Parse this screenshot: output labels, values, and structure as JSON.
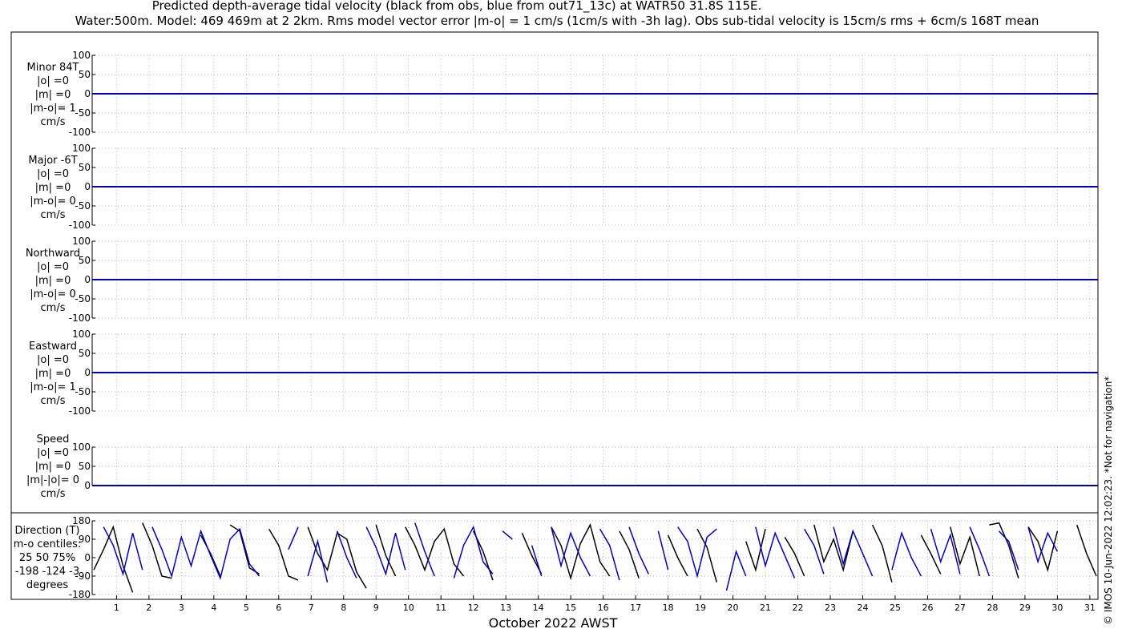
{
  "title": {
    "line1": "Predicted depth-average tidal velocity (black from obs, blue from out71_13c) at WATR50 31.8S 115E.",
    "line2": "Water:500m. Model: 469 469m at 2 2km. Rms model vector error |m-o| = 1 cm/s (1cm/s with -3h lag). Obs sub-tidal velocity is 15cm/s rms + 6cm/s 168T mean"
  },
  "credit": "© IMOS 10-Jun-2022 12:02:23. *Not for navigation*",
  "colors": {
    "obs": "#000000",
    "model": "#0000c0"
  },
  "chart_data": [
    {
      "type": "line",
      "label_lines": [
        "Minor 84T",
        "|o| =0",
        "|m| =0",
        "|m-o|= 1",
        "cm/s"
      ],
      "ylim": [
        -100,
        100
      ],
      "yticks": [
        "100",
        "50",
        "0",
        "-50",
        "-100"
      ],
      "series": [
        {
          "values": [
            0,
            0,
            0,
            0,
            0,
            0,
            0,
            0,
            0,
            0,
            0,
            0,
            0,
            0,
            0,
            0,
            0,
            0,
            0,
            0,
            0,
            0,
            0,
            0,
            0,
            0,
            0,
            0,
            0,
            0,
            0,
            0
          ]
        },
        {
          "values": [
            0,
            0,
            0,
            0,
            0,
            0,
            0,
            0,
            0,
            0,
            0,
            0,
            0,
            0,
            0,
            0,
            0,
            0,
            0,
            0,
            0,
            0,
            0,
            0,
            0,
            0,
            0,
            0,
            0,
            0,
            0,
            0
          ]
        }
      ]
    },
    {
      "type": "line",
      "label_lines": [
        "Major -6T",
        "|o| =0",
        "|m| =0",
        "|m-o|= 0",
        "cm/s"
      ],
      "ylim": [
        -100,
        100
      ],
      "yticks": [
        "100",
        "50",
        "0",
        "-50",
        "-100"
      ],
      "series": [
        {
          "values": [
            0,
            0,
            0,
            0,
            0,
            0,
            0,
            0,
            0,
            0,
            0,
            0,
            0,
            0,
            0,
            0,
            0,
            0,
            0,
            0,
            0,
            0,
            0,
            0,
            0,
            0,
            0,
            0,
            0,
            0,
            0,
            0
          ]
        },
        {
          "values": [
            0,
            0,
            0,
            0,
            0,
            0,
            0,
            0,
            0,
            0,
            0,
            0,
            0,
            0,
            0,
            0,
            0,
            0,
            0,
            0,
            0,
            0,
            0,
            0,
            0,
            0,
            0,
            0,
            0,
            0,
            0,
            0
          ]
        }
      ]
    },
    {
      "type": "line",
      "label_lines": [
        "Northward",
        "|o| =0",
        "|m| =0",
        "|m-o|= 0",
        "cm/s"
      ],
      "ylim": [
        -100,
        100
      ],
      "yticks": [
        "100",
        "50",
        "0",
        "-50",
        "-100"
      ],
      "series": [
        {
          "values": [
            0,
            0,
            0,
            0,
            0,
            0,
            0,
            0,
            0,
            0,
            0,
            0,
            0,
            0,
            0,
            0,
            0,
            0,
            0,
            0,
            0,
            0,
            0,
            0,
            0,
            0,
            0,
            0,
            0,
            0,
            0,
            0
          ]
        },
        {
          "values": [
            0,
            0,
            0,
            0,
            0,
            0,
            0,
            0,
            0,
            0,
            0,
            0,
            0,
            0,
            0,
            0,
            0,
            0,
            0,
            0,
            0,
            0,
            0,
            0,
            0,
            0,
            0,
            0,
            0,
            0,
            0,
            0
          ]
        }
      ]
    },
    {
      "type": "line",
      "label_lines": [
        "Eastward",
        "|o| =0",
        "|m| =0",
        "|m-o|= 1",
        "cm/s"
      ],
      "ylim": [
        -100,
        100
      ],
      "yticks": [
        "100",
        "50",
        "0",
        "-50",
        "-100"
      ],
      "series": [
        {
          "values": [
            0,
            0,
            0,
            0,
            0,
            0,
            0,
            0,
            0,
            0,
            0,
            0,
            0,
            0,
            0,
            0,
            0,
            0,
            0,
            0,
            0,
            0,
            0,
            0,
            0,
            0,
            0,
            0,
            0,
            0,
            0,
            0
          ]
        },
        {
          "values": [
            0,
            0,
            0,
            0,
            0,
            0,
            0,
            0,
            0,
            0,
            0,
            0,
            0,
            0,
            0,
            0,
            0,
            0,
            0,
            0,
            0,
            0,
            0,
            0,
            0,
            0,
            0,
            0,
            0,
            0,
            0,
            0
          ]
        }
      ]
    },
    {
      "type": "line",
      "label_lines": [
        "Speed",
        "|o| =0",
        "|m| =0",
        "|m|-|o|= 0",
        "cm/s"
      ],
      "ylim": [
        0,
        100
      ],
      "yticks": [
        "100",
        "50",
        "0"
      ],
      "series": [
        {
          "values": [
            0,
            0,
            0,
            0,
            0,
            0,
            0,
            0,
            0,
            0,
            0,
            0,
            0,
            0,
            0,
            0,
            0,
            0,
            0,
            0,
            0,
            0,
            0,
            0,
            0,
            0,
            0,
            0,
            0,
            0,
            0,
            0
          ]
        },
        {
          "values": [
            0,
            0,
            0,
            0,
            0,
            0,
            0,
            0,
            0,
            0,
            0,
            0,
            0,
            0,
            0,
            0,
            0,
            0,
            0,
            0,
            0,
            0,
            0,
            0,
            0,
            0,
            0,
            0,
            0,
            0,
            0,
            0
          ]
        }
      ]
    },
    {
      "type": "line",
      "label_lines": [
        "Direction (T)",
        "m-o centiles:",
        "25  50  75%",
        "-198 -124   -3",
        "degrees"
      ],
      "ylim": [
        -180,
        180
      ],
      "yticks": [
        "180",
        "90",
        "0",
        "-90",
        "-180"
      ],
      "x": [
        0.3,
        0.6,
        0.9,
        1.2,
        1.5,
        1.8,
        2.1,
        2.4,
        2.7,
        3.0,
        3.3,
        3.6,
        3.9,
        4.2,
        4.5,
        4.8,
        5.1,
        5.4,
        5.7,
        6.0,
        6.3,
        6.6,
        6.9,
        7.2,
        7.5,
        7.8,
        8.1,
        8.4,
        8.7,
        9.0,
        9.3,
        9.6,
        9.9,
        10.2,
        10.5,
        10.8,
        11.1,
        11.4,
        11.7,
        12.0,
        12.3,
        12.6,
        12.9,
        13.2,
        13.5,
        13.8,
        14.1,
        14.4,
        14.7,
        15.0,
        15.3,
        15.6,
        15.9,
        16.2,
        16.5,
        16.8,
        17.1,
        17.4,
        17.7,
        18.0,
        18.3,
        18.6,
        18.9,
        19.2,
        19.5,
        19.8,
        20.1,
        20.4,
        20.7,
        21.0,
        21.3,
        21.6,
        21.9,
        22.2,
        22.5,
        22.8,
        23.1,
        23.4,
        23.7,
        24.0,
        24.3,
        24.6,
        24.9,
        25.2,
        25.5,
        25.8,
        26.1,
        26.4,
        26.7,
        27.0,
        27.3,
        27.6,
        27.9,
        28.2,
        28.5,
        28.8,
        29.1,
        29.4,
        29.7,
        30.0,
        30.3,
        30.6,
        30.9,
        31.2
      ],
      "series": [
        {
          "values": [
            -60,
            40,
            150,
            -40,
            -170,
            170,
            60,
            -90,
            -100,
            150,
            -170,
            110,
            20,
            -90,
            160,
            130,
            -50,
            -80,
            140,
            60,
            -90,
            -110,
            150,
            20,
            -60,
            120,
            90,
            -70,
            -150,
            160,
            10,
            -90,
            150,
            60,
            -60,
            80,
            140,
            -30,
            -90,
            130,
            30,
            -110,
            150,
            -160,
            120,
            10,
            -80,
            150,
            60,
            -100,
            70,
            160,
            -20,
            -90,
            130,
            40,
            -100,
            150,
            -170,
            110,
            0,
            -90,
            140,
            50,
            -120,
            160,
            -140,
            80,
            -60,
            140,
            -150,
            100,
            20,
            -90,
            160,
            -20,
            90,
            -60,
            130,
            -80,
            160,
            60,
            -120,
            140,
            -160,
            110,
            20,
            -80,
            150,
            -30,
            100,
            -90,
            160,
            170,
            60,
            -100,
            150,
            80,
            -60,
            130,
            -120,
            160,
            20,
            -90
          ]
        },
        {
          "values": [
            -90,
            150,
            60,
            -80,
            120,
            -60,
            150,
            40,
            -90,
            100,
            -40,
            130,
            10,
            -100,
            90,
            140,
            -30,
            -90,
            160,
            -170,
            40,
            150,
            -90,
            80,
            -120,
            130,
            0,
            -100,
            150,
            50,
            -80,
            120,
            -60,
            170,
            30,
            -90,
            140,
            -100,
            60,
            150,
            -20,
            -80,
            130,
            90,
            -150,
            60,
            -90,
            150,
            -40,
            120,
            0,
            -90,
            140,
            60,
            -110,
            150,
            20,
            -80,
            130,
            -60,
            150,
            80,
            -90,
            100,
            140,
            -160,
            30,
            -90,
            150,
            -40,
            120,
            10,
            -100,
            140,
            60,
            -80,
            150,
            -30,
            130,
            20,
            -90,
            150,
            -60,
            120,
            0,
            -90,
            140,
            -20,
            110,
            -80,
            150,
            40,
            -90,
            130,
            80,
            -60,
            150,
            -20,
            120,
            30
          ]
        }
      ]
    }
  ],
  "xaxis": {
    "label": "October 2022 AWST",
    "ticks": [
      "1",
      "2",
      "3",
      "4",
      "5",
      "6",
      "7",
      "8",
      "9",
      "10",
      "11",
      "12",
      "13",
      "14",
      "15",
      "16",
      "17",
      "18",
      "19",
      "20",
      "21",
      "22",
      "23",
      "24",
      "25",
      "26",
      "27",
      "28",
      "29",
      "30",
      "31"
    ],
    "range": [
      0.25,
      31.25
    ]
  }
}
